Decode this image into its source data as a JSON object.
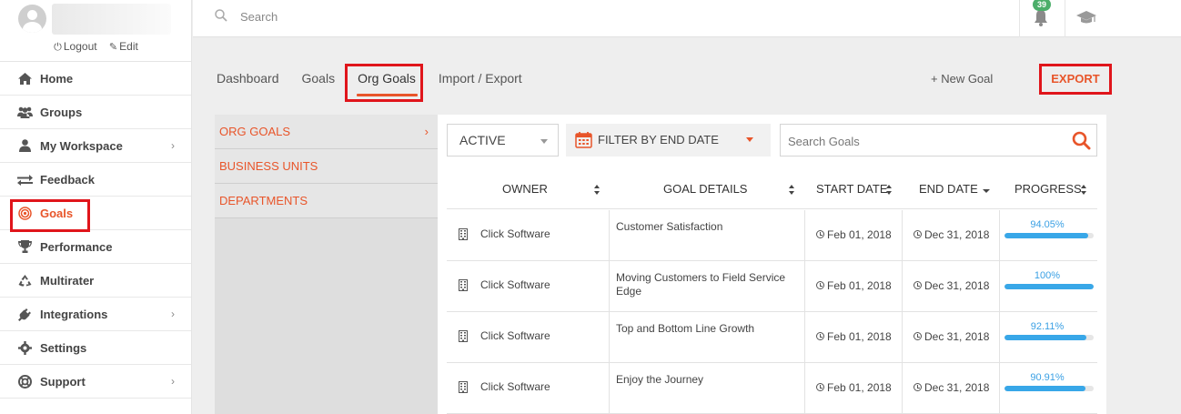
{
  "profile": {
    "logout_label": "Logout",
    "edit_label": "Edit"
  },
  "sidebar": {
    "items": [
      {
        "label": "Home",
        "icon": "home-icon",
        "has_arrow": false
      },
      {
        "label": "Groups",
        "icon": "users-icon",
        "has_arrow": false
      },
      {
        "label": "My Workspace",
        "icon": "user-icon",
        "has_arrow": true
      },
      {
        "label": "Feedback",
        "icon": "exchange-icon",
        "has_arrow": false
      },
      {
        "label": "Goals",
        "icon": "target-icon",
        "has_arrow": false,
        "active": true
      },
      {
        "label": "Performance",
        "icon": "trophy-icon",
        "has_arrow": false
      },
      {
        "label": "Multirater",
        "icon": "recycle-icon",
        "has_arrow": false
      },
      {
        "label": "Integrations",
        "icon": "plug-icon",
        "has_arrow": true
      },
      {
        "label": "Settings",
        "icon": "gear-icon",
        "has_arrow": false
      },
      {
        "label": "Support",
        "icon": "lifebuoy-icon",
        "has_arrow": true
      }
    ]
  },
  "topbar": {
    "search_placeholder": "Search",
    "notification_count": "39"
  },
  "tabs": [
    {
      "label": "Dashboard"
    },
    {
      "label": "Goals"
    },
    {
      "label": "Org Goals",
      "active": true
    },
    {
      "label": "Import / Export"
    }
  ],
  "actions": {
    "new_goal_label": "+ New Goal",
    "export_label": "EXPORT"
  },
  "submenu": [
    {
      "label": "ORG GOALS",
      "has_arrow": true
    },
    {
      "label": "BUSINESS UNITS"
    },
    {
      "label": "DEPARTMENTS"
    }
  ],
  "filters": {
    "status_value": "ACTIVE",
    "date_filter_label": "FILTER BY END DATE",
    "goal_search_placeholder": "Search Goals"
  },
  "table": {
    "headers": [
      "OWNER",
      "GOAL DETAILS",
      "START DATE",
      "END DATE",
      "PROGRESS"
    ],
    "rows": [
      {
        "owner": "Click Software",
        "details": "Customer Satisfaction",
        "start": "Feb 01, 2018",
        "end": "Dec 31, 2018",
        "progress_label": "94.05%",
        "progress": 94.05
      },
      {
        "owner": "Click Software",
        "details": "Moving Customers to Field Service Edge",
        "start": "Feb 01, 2018",
        "end": "Dec 31, 2018",
        "progress_label": "100%",
        "progress": 100
      },
      {
        "owner": "Click Software",
        "details": "Top and Bottom Line Growth",
        "start": "Feb 01, 2018",
        "end": "Dec 31, 2018",
        "progress_label": "92.11%",
        "progress": 92.11
      },
      {
        "owner": "Click Software",
        "details": "Enjoy the Journey",
        "start": "Feb 01, 2018",
        "end": "Dec 31, 2018",
        "progress_label": "90.91%",
        "progress": 90.91
      }
    ]
  },
  "colors": {
    "accent": "#e8552a",
    "highlight": "#e0151b",
    "progress": "#38a7e8",
    "badge": "#4cae6a"
  }
}
